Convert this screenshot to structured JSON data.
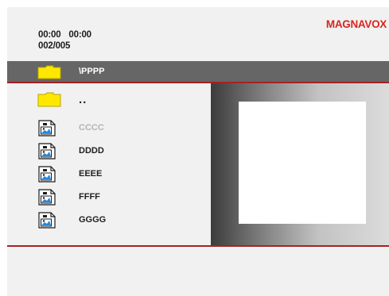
{
  "header": {
    "elapsed_time": "00:00",
    "total_time": "00:00",
    "track_counter": "002/005",
    "brand": "MAGNAVOX"
  },
  "path_bar": {
    "folder_icon": "folder-icon",
    "path": "\\PPPP"
  },
  "file_list": {
    "items": [
      {
        "label": "..",
        "icon": "folder-icon",
        "kind": "parent-folder"
      },
      {
        "label": "CCCC",
        "icon": "picture-file-icon",
        "kind": "file",
        "state": "dimmed"
      },
      {
        "label": "DDDD",
        "icon": "picture-file-icon",
        "kind": "file"
      },
      {
        "label": "EEEE",
        "icon": "picture-file-icon",
        "kind": "file"
      },
      {
        "label": "FFFF",
        "icon": "picture-file-icon",
        "kind": "file"
      },
      {
        "label": "GGGG",
        "icon": "picture-file-icon",
        "kind": "file"
      }
    ]
  },
  "colors": {
    "screen_background": "#f1f1f1",
    "path_bar_background": "#666666",
    "accent_red": "#a52222",
    "brand_red": "#d7261e",
    "folder_yellow": "#ffe800",
    "dimmed_text": "#b4b4b4"
  }
}
